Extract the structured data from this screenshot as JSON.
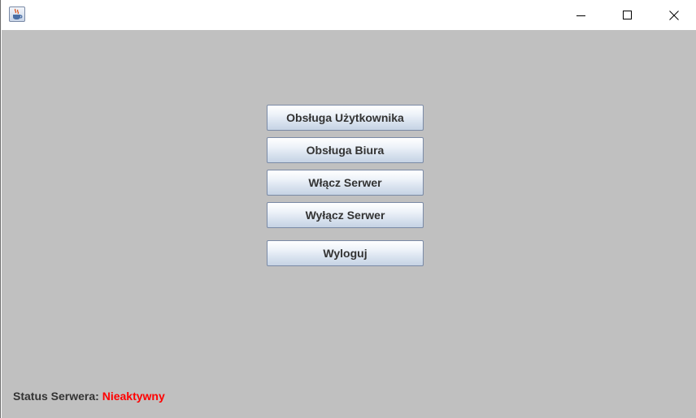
{
  "window": {
    "icon": "java-cup-icon",
    "controls": [
      "minimize-icon",
      "maximize-icon",
      "close-icon"
    ]
  },
  "menu": {
    "buttons": [
      "Obsługa Użytkownika",
      "Obsługa Biura",
      "Włącz Serwer",
      "Wyłącz Serwer",
      "Wyloguj"
    ]
  },
  "status": {
    "label": "Status Serwera:",
    "value": "Nieaktywny",
    "value_color": "#ff0000"
  }
}
